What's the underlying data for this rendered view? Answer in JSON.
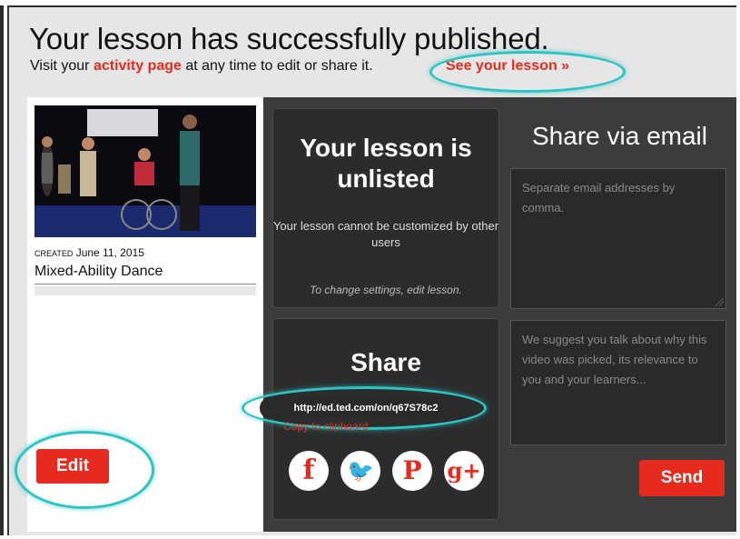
{
  "header": {
    "title": "Your lesson has successfully published.",
    "subtitle_prefix": "Visit your ",
    "activity_link": "activity page",
    "subtitle_suffix": " at any time to edit or share it.",
    "see_lesson_link": "See your lesson »"
  },
  "lesson": {
    "created_label": "CREATED",
    "created_date": "June 11, 2015",
    "name": "Mixed-Ability Dance",
    "edit_label": "Edit"
  },
  "unlisted": {
    "heading": "Your lesson is unlisted",
    "description": "Your lesson cannot be customized by other users",
    "note": "To change settings, edit lesson."
  },
  "share": {
    "heading": "Share",
    "url": "http://ed.ted.com/on/q67S78c2",
    "copy_label": "Copy to clipboard",
    "social": [
      {
        "icon": "facebook-icon",
        "glyph": "f"
      },
      {
        "icon": "twitter-icon",
        "glyph": "🐦"
      },
      {
        "icon": "pinterest-icon",
        "glyph": "P"
      },
      {
        "icon": "google-plus-icon",
        "glyph": "g+"
      }
    ]
  },
  "email": {
    "heading": "Share via email",
    "addresses_placeholder": "Separate email addresses by comma.",
    "message_placeholder": "We suggest you talk about why this video was picked, its relevance to you and your learners...",
    "send_label": "Send"
  },
  "colors": {
    "accent": "#e62b1e",
    "highlight_ring": "#2ec4c4",
    "dark_panel": "#3c3c3c"
  }
}
